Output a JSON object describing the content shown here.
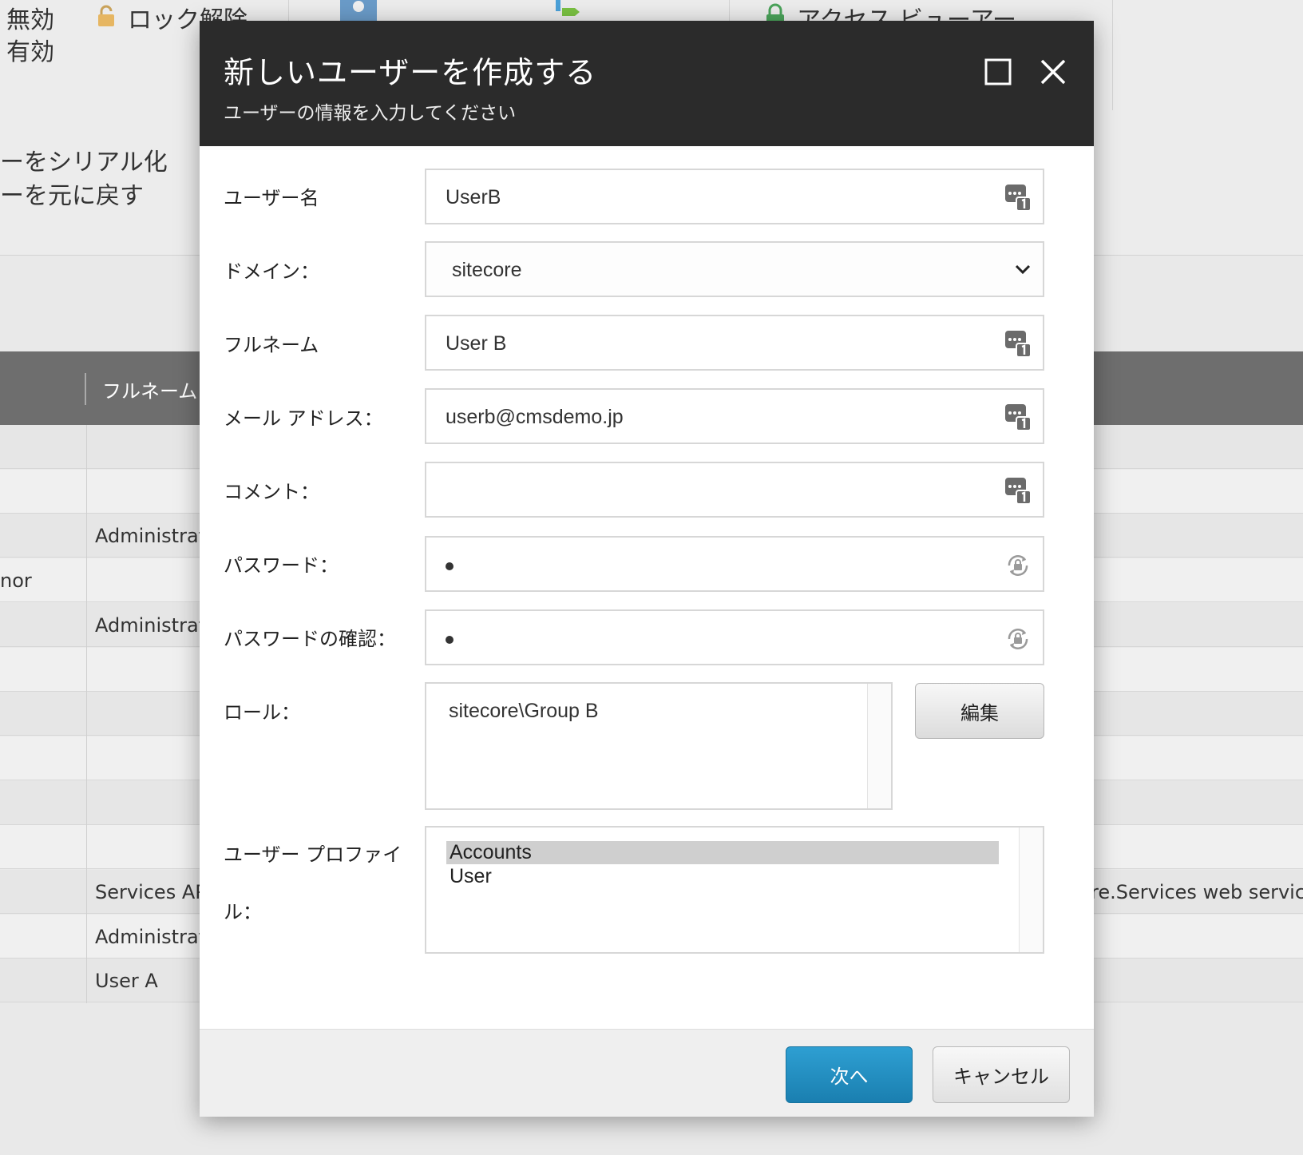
{
  "background": {
    "ribbon": {
      "disable_label": "無効",
      "enable_label": "有効",
      "unlock_label": "ロック解除",
      "access_viewer_label": "アクセス ビューアー",
      "serialize_label": "ーをシリアル化",
      "revert_label": "ーを元に戻す"
    },
    "table": {
      "header_fullname": "フルネーム",
      "rows": [
        {
          "left": "",
          "name": ""
        },
        {
          "left": "",
          "name": ""
        },
        {
          "left": "",
          "name": "Administrato"
        },
        {
          "left": "nor",
          "name": ""
        },
        {
          "left": "",
          "name": "Administrato"
        },
        {
          "left": "",
          "name": ""
        },
        {
          "left": "",
          "name": ""
        },
        {
          "left": "",
          "name": ""
        },
        {
          "left": "",
          "name": ""
        },
        {
          "left": "",
          "name": ""
        },
        {
          "left": "",
          "name": "Services API"
        },
        {
          "left": "",
          "name": "Administrato"
        },
        {
          "left": "",
          "name": "User A"
        }
      ],
      "right_cell": "re.Services web service A"
    }
  },
  "dialog": {
    "title": "新しいユーザーを作成する",
    "subtitle": "ユーザーの情報を入力してください",
    "fields": {
      "username": {
        "label": "ユーザー名",
        "value": "UserB"
      },
      "domain": {
        "label": "ドメイン：",
        "value": "sitecore"
      },
      "fullname": {
        "label": "フルネーム",
        "value": "User B"
      },
      "email": {
        "label": "メール アドレス：",
        "value": "userb@cmsdemo.jp"
      },
      "comment": {
        "label": "コメント：",
        "value": ""
      },
      "password": {
        "label": "パスワード：",
        "value": "•"
      },
      "password_confirm": {
        "label": "パスワードの確認：",
        "value": "•"
      },
      "roles": {
        "label": "ロール：",
        "items": [
          "sitecore\\Group B"
        ],
        "edit_label": "編集"
      },
      "profile": {
        "label_line1": "ユーザー プロファイ",
        "label_line2": "ル：",
        "items": [
          "Accounts",
          "User"
        ],
        "selected": "Accounts"
      }
    },
    "buttons": {
      "next": "次へ",
      "cancel": "キャンセル"
    }
  },
  "colors": {
    "header_bg": "#2b2b2b",
    "primary_button": "#1f8cc0"
  }
}
